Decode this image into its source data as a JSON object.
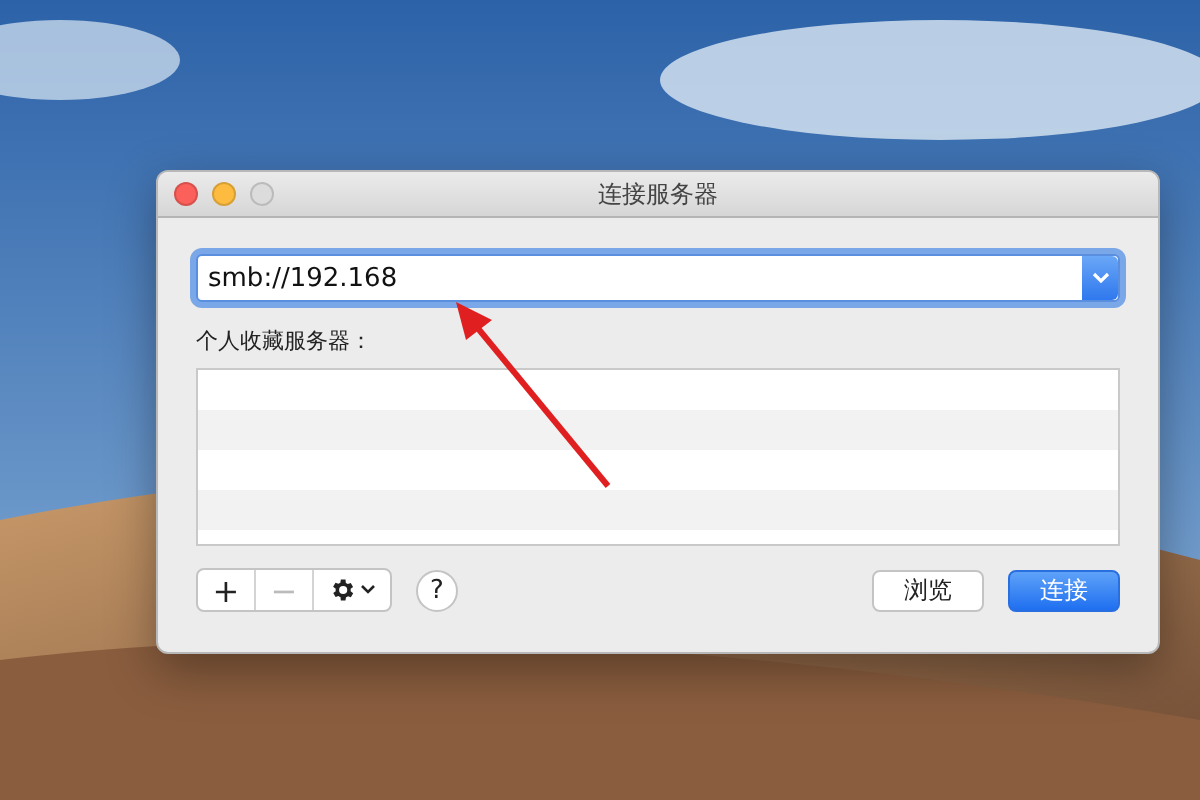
{
  "window": {
    "title": "连接服务器"
  },
  "server_field": {
    "value": "smb://192.168"
  },
  "favorites": {
    "label": "个人收藏服务器："
  },
  "toolbar": {
    "add": {
      "label": "+",
      "disabled": false
    },
    "remove": {
      "label": "−",
      "disabled": true
    },
    "help": {
      "label": "?"
    }
  },
  "buttons": [
    {
      "label": "浏览",
      "kind": "normal"
    },
    {
      "label": "连接",
      "kind": "default"
    }
  ]
}
